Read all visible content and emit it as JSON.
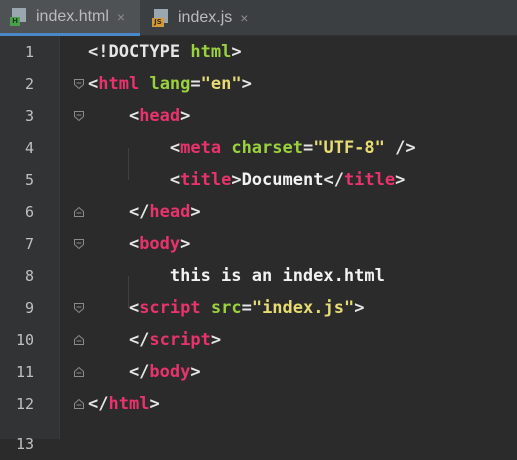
{
  "tabs": [
    {
      "label": "index.html",
      "icon": "html-file-icon",
      "active": true,
      "close": "×"
    },
    {
      "label": "index.js",
      "icon": "js-file-icon",
      "active": false,
      "close": "×"
    }
  ],
  "icon_badges": {
    "html": "H",
    "js": "JS"
  },
  "lines": [
    {
      "num": "1",
      "tokens": [
        {
          "t": "<!DOCTYPE ",
          "c": "br"
        },
        {
          "t": "html",
          "c": "at"
        },
        {
          "t": ">",
          "c": "br"
        }
      ]
    },
    {
      "num": "2",
      "tokens": [
        {
          "t": "<",
          "c": "br"
        },
        {
          "t": "html",
          "c": "tg"
        },
        {
          "t": " ",
          "c": "br"
        },
        {
          "t": "lang",
          "c": "at"
        },
        {
          "t": "=",
          "c": "br"
        },
        {
          "t": "\"en\"",
          "c": "st"
        },
        {
          "t": ">",
          "c": "br"
        }
      ]
    },
    {
      "num": "3",
      "tokens": [
        {
          "t": "    <",
          "c": "br"
        },
        {
          "t": "head",
          "c": "tg"
        },
        {
          "t": ">",
          "c": "br"
        }
      ]
    },
    {
      "num": "4",
      "tokens": [
        {
          "t": "        <",
          "c": "br"
        },
        {
          "t": "meta",
          "c": "tg"
        },
        {
          "t": " ",
          "c": "br"
        },
        {
          "t": "charset",
          "c": "at"
        },
        {
          "t": "=",
          "c": "br"
        },
        {
          "t": "\"UTF-8\"",
          "c": "st"
        },
        {
          "t": " />",
          "c": "br"
        }
      ]
    },
    {
      "num": "5",
      "tokens": [
        {
          "t": "        <",
          "c": "br"
        },
        {
          "t": "title",
          "c": "tg"
        },
        {
          "t": ">",
          "c": "br"
        },
        {
          "t": "Document",
          "c": "tx"
        },
        {
          "t": "</",
          "c": "br"
        },
        {
          "t": "title",
          "c": "tg"
        },
        {
          "t": ">",
          "c": "br"
        }
      ]
    },
    {
      "num": "6",
      "tokens": [
        {
          "t": "    </",
          "c": "br"
        },
        {
          "t": "head",
          "c": "tg"
        },
        {
          "t": ">",
          "c": "br"
        }
      ]
    },
    {
      "num": "7",
      "tokens": [
        {
          "t": "    <",
          "c": "br"
        },
        {
          "t": "body",
          "c": "tg"
        },
        {
          "t": ">",
          "c": "br"
        }
      ]
    },
    {
      "num": "8",
      "tokens": [
        {
          "t": "        this is an index.html",
          "c": "tx"
        }
      ]
    },
    {
      "num": "9",
      "tokens": [
        {
          "t": "    <",
          "c": "br"
        },
        {
          "t": "script",
          "c": "tg"
        },
        {
          "t": " ",
          "c": "br"
        },
        {
          "t": "src",
          "c": "at"
        },
        {
          "t": "=",
          "c": "br"
        },
        {
          "t": "\"index.js\"",
          "c": "st"
        },
        {
          "t": ">",
          "c": "br"
        }
      ]
    },
    {
      "num": "10",
      "tokens": [
        {
          "t": "    </",
          "c": "br"
        },
        {
          "t": "script",
          "c": "tg"
        },
        {
          "t": ">",
          "c": "br"
        }
      ]
    },
    {
      "num": "11",
      "tokens": [
        {
          "t": "    </",
          "c": "br"
        },
        {
          "t": "body",
          "c": "tg"
        },
        {
          "t": ">",
          "c": "br"
        }
      ]
    },
    {
      "num": "12",
      "tokens": [
        {
          "t": "</",
          "c": "br"
        },
        {
          "t": "html",
          "c": "tg"
        },
        {
          "t": ">",
          "c": "br"
        }
      ]
    }
  ],
  "partial_line_num": "13",
  "colors": {
    "tag": "#e8336d",
    "attr": "#9bd13d",
    "string": "#e7db74",
    "text": "#f2f2f2",
    "background": "#2b2b2b",
    "gutter": "#313335"
  }
}
